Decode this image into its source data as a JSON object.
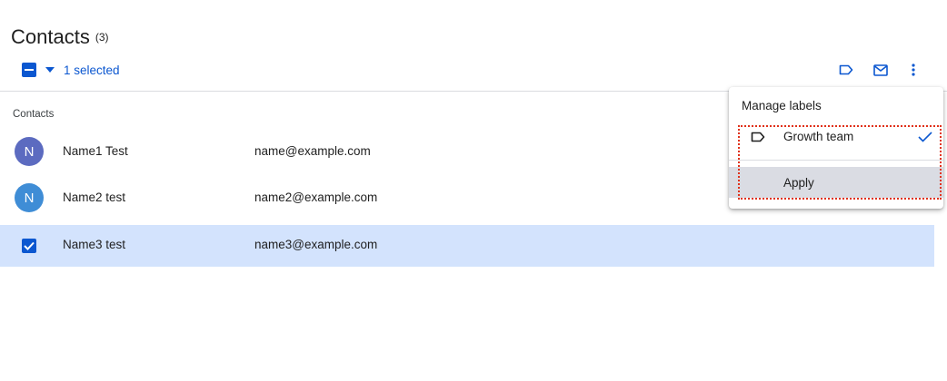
{
  "header": {
    "title": "Contacts",
    "count": "(3)"
  },
  "toolbar": {
    "selected_text": "1 selected",
    "icons": [
      "label-icon",
      "email-icon",
      "more-vert-icon"
    ]
  },
  "list": {
    "section_label": "Contacts",
    "rows": [
      {
        "avatar": "N",
        "avatar_color": "#5c6bc0",
        "name": "Name1 Test",
        "email": "name@example.com",
        "selected": false
      },
      {
        "avatar": "N",
        "avatar_color": "#3f8dd6",
        "name": "Name2 test",
        "email": "name2@example.com",
        "selected": false
      },
      {
        "avatar": "",
        "avatar_color": "",
        "name": "Name3 test",
        "email": "name3@example.com",
        "selected": true
      }
    ]
  },
  "menu": {
    "header": "Manage labels",
    "items": [
      {
        "label": "Growth team",
        "checked": true
      }
    ],
    "apply_label": "Apply"
  },
  "colors": {
    "accent": "#0b57d0",
    "selected_row": "#d3e3fd",
    "highlight": "#e0311a"
  }
}
